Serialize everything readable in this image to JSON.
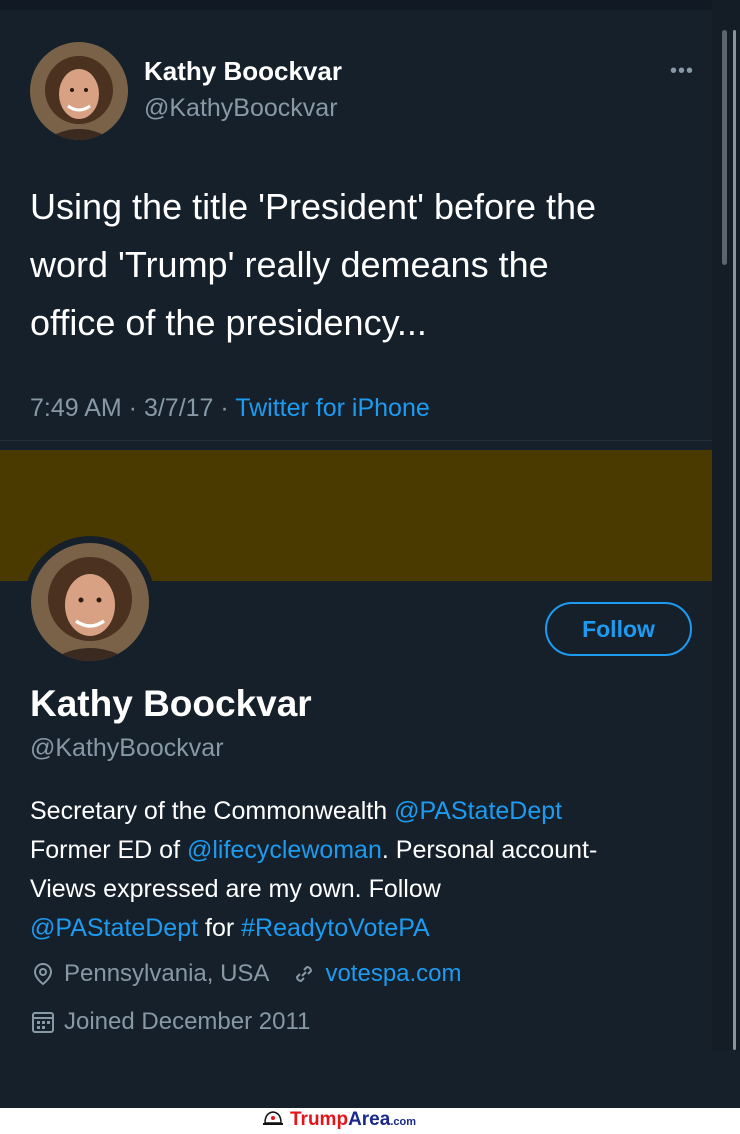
{
  "tweet": {
    "author_name": "Kathy Boockvar",
    "author_handle": "@KathyBoockvar",
    "more_label": "•••",
    "text": "Using the title 'President' before the\nword 'Trump' really demeans the\noffice of the presidency...",
    "timestamp": "7:49 AM · 3/7/17 · ",
    "source": "Twitter for iPhone"
  },
  "profile": {
    "name": "Kathy Boockvar",
    "handle": "@KathyBoockvar",
    "follow_label": "Follow",
    "bio": {
      "line1_text": "Secretary of the Commonwealth ",
      "line1_link": "@PAStateDept",
      "line2_text": "Former ED of ",
      "line2_link": "@lifecyclewoman",
      "line2_tail": ". Personal account-",
      "line3_text": "Views expressed are my own. Follow",
      "line4_link": "@PAStateDept",
      "line4_text": " for ",
      "line4_hashtag": "#ReadytoVotePA"
    },
    "location": "Pennsylvania, USA",
    "website": "votespa.com",
    "joined": "Joined December 2011"
  },
  "colors": {
    "background": "#15202b",
    "accent": "#1d9bf0",
    "secondary_text": "#8899a6",
    "banner": "#4a3a00"
  },
  "icons": [
    "more-icon",
    "location-icon",
    "link-icon",
    "calendar-icon",
    "trump-hat-icon"
  ],
  "watermark": {
    "brand_primary": "Trump",
    "brand_secondary": "Area",
    "brand_suffix": ".com"
  }
}
